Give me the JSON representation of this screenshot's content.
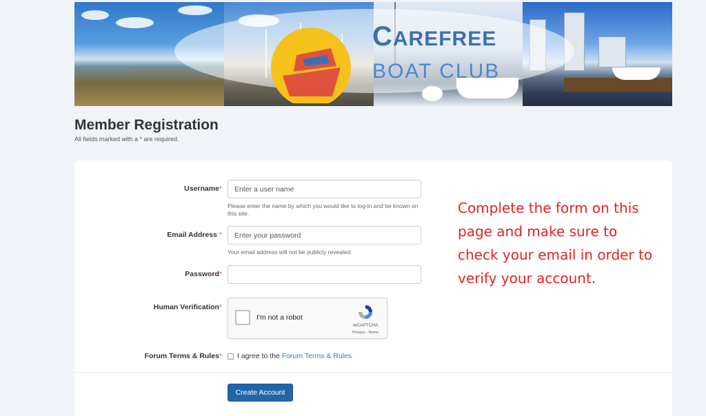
{
  "banner": {
    "logo_line1_big": "C",
    "logo_line1_rest": "AREFREE",
    "logo_line2": "BOAT CLUB",
    "colors": {
      "logo_blue": "#3e6fb0",
      "sun_yellow": "#f5c21b",
      "boat_red": "#e0523e"
    }
  },
  "page": {
    "title": "Member Registration",
    "subtitle": "All fields marked with a * are required."
  },
  "form": {
    "username": {
      "label": "Username",
      "star": "*",
      "placeholder": "Enter a user name",
      "help": "Please enter the name by which you would like to log-in and be known on this site."
    },
    "email": {
      "label": "Email Address ",
      "star": "*",
      "placeholder": "Enter your password",
      "help": "Your email address will not be publicly revealed."
    },
    "password": {
      "label": "Password",
      "star": "*",
      "placeholder": ""
    },
    "human": {
      "label": "Human Verification",
      "star": "*"
    },
    "captcha": {
      "text": "I'm not a robot",
      "brand": "reCAPTCHA",
      "links": "Privacy - Terms"
    },
    "terms": {
      "label": "Forum Terms & Rules",
      "star": "*",
      "agree_text": "I agree to the ",
      "link_text": "Forum Terms & Rules"
    },
    "submit_label": "Create Account"
  },
  "annotation": {
    "text": "Complete the form on this page and make sure to check your email in order to verify your account.",
    "color": "#e02424"
  }
}
